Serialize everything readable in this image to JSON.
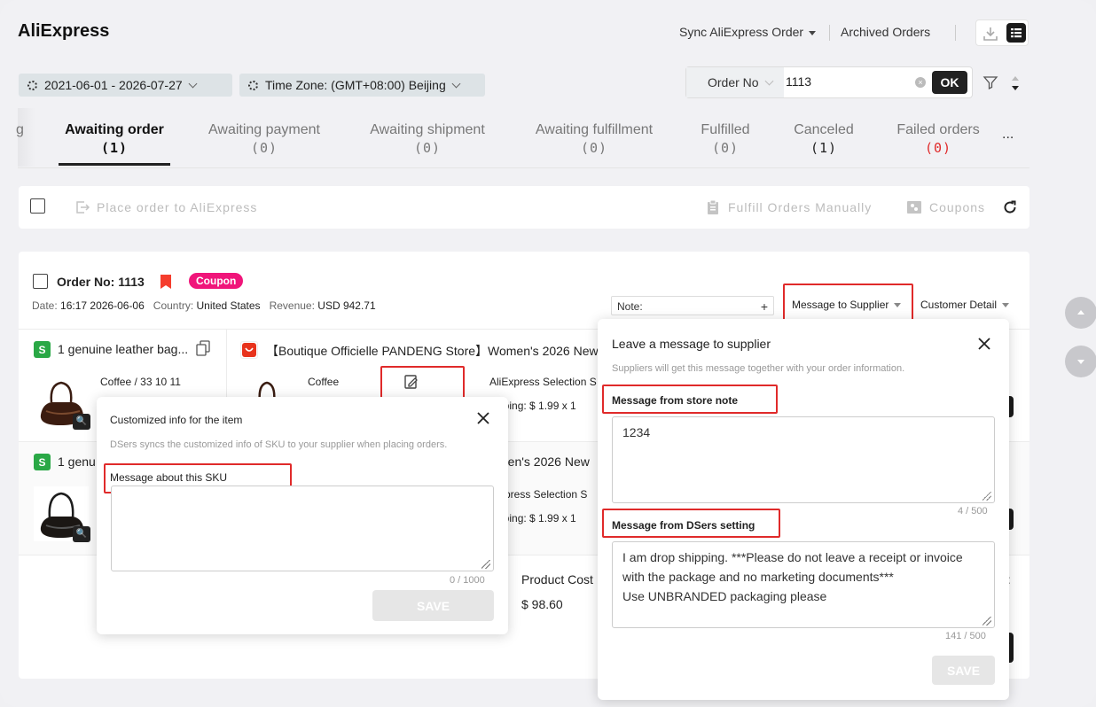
{
  "app": {
    "title": "AliExpress"
  },
  "topnav": {
    "sync_label": "Sync AliExpress Order",
    "archived_label": "Archived Orders"
  },
  "filters": {
    "date_range": "2021-06-01 - 2026-07-27",
    "timezone": "Time Zone: (GMT+08:00) Beijing"
  },
  "search": {
    "field": "Order No",
    "value": "1113",
    "ok_label": "OK"
  },
  "tabs": [
    {
      "label": "g",
      "count": ""
    },
    {
      "label": "Awaiting order",
      "count": "(1)"
    },
    {
      "label": "Awaiting payment",
      "count": "(0)"
    },
    {
      "label": "Awaiting shipment",
      "count": "(0)"
    },
    {
      "label": "Awaiting fulfillment",
      "count": "(0)"
    },
    {
      "label": "Fulfilled",
      "count": "(0)"
    },
    {
      "label": "Canceled",
      "count": "(1)"
    },
    {
      "label": "Failed orders",
      "count": "(0)"
    },
    {
      "label": "...",
      "count": ""
    }
  ],
  "actions": {
    "place_order": "Place order to AliExpress",
    "fulfill": "Fulfill Orders Manually",
    "coupons": "Coupons"
  },
  "order": {
    "no_label": "Order No:",
    "no_value": "1113",
    "coupon_badge": "Coupon",
    "date_label": "Date:",
    "date_value": "16:17 2026-06-06",
    "country_label": "Country:",
    "country_value": "United States",
    "revenue_label": "Revenue:",
    "revenue_value": "USD 942.71",
    "note_label": "Note:",
    "note_plus": "+",
    "message_supplier": "Message to Supplier",
    "customer_detail": "Customer Detail",
    "items": [
      {
        "title": "1 genuine leather bag...",
        "variant": "Coffee / 33 10 11",
        "ali_title": "【Boutique Officielle PANDENG Store】Women's 2026 New",
        "ali_variant": "Coffee",
        "shipping_method": "AliExpress Selection S",
        "shipping_cost": "pping: $ 1.99 x 1"
      },
      {
        "title": "1 genu",
        "ali_title": "men's 2026 New",
        "shipping_method": "xpress Selection S",
        "shipping_cost": "pping: $ 1.99 x 1"
      }
    ],
    "product_cost_label": "Product Cost",
    "product_cost_value": "$ 98.60",
    "right_label": "t"
  },
  "sku_popup": {
    "title": "Customized info for the item",
    "desc": "DSers syncs the customized info of SKU to your supplier when placing orders.",
    "field_label": "Message about this SKU",
    "value": "",
    "counter": "0 / 1000",
    "save": "SAVE"
  },
  "supplier_popup": {
    "title": "Leave a message to supplier",
    "desc": "Suppliers will get this message together with your order information.",
    "store_note_label": "Message from store note",
    "store_note_value": "1234",
    "store_counter": "4 / 500",
    "dsers_label": "Message from DSers setting",
    "dsers_value": "I am drop shipping. ***Please do not leave a receipt or invoice with the package and no marketing documents***\nUse UNBRANDED packaging please",
    "dsers_counter": "141 / 500",
    "save": "SAVE"
  },
  "colors": {
    "accent": "#e02a2a",
    "coupon": "#f0157a",
    "failed": "#e02a2a",
    "dark": "#1a1a1a"
  }
}
